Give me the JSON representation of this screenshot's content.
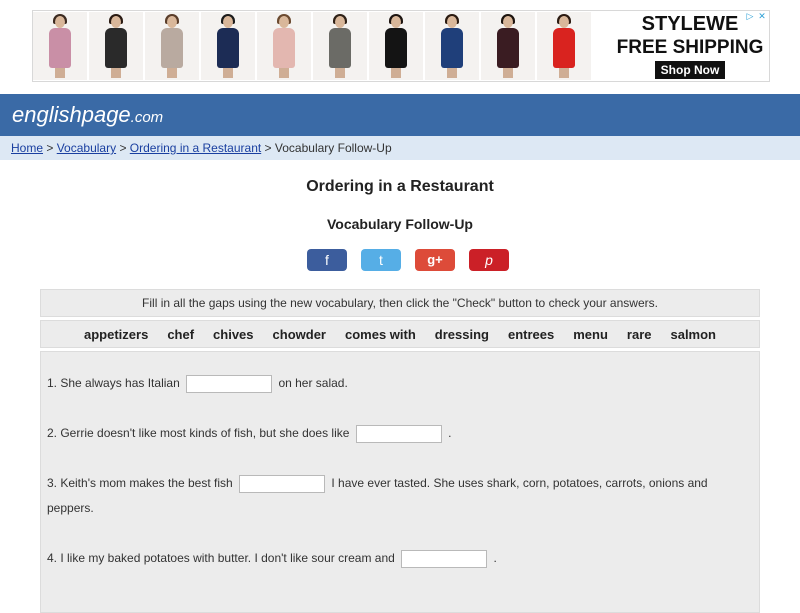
{
  "ad": {
    "brand": "STYLEWE",
    "headline": "FREE SHIPPING",
    "button": "Shop Now",
    "tiles": [
      {
        "dress": "#c98fa6",
        "hair": "#3b2a20"
      },
      {
        "dress": "#2a2a2a",
        "hair": "#2a1a12"
      },
      {
        "dress": "#b9aaa0",
        "hair": "#5a3d2a"
      },
      {
        "dress": "#1c2c55",
        "hair": "#1b1b1b"
      },
      {
        "dress": "#e3b7b0",
        "hair": "#6b4a30"
      },
      {
        "dress": "#6b6b66",
        "hair": "#2e2016"
      },
      {
        "dress": "#141414",
        "hair": "#1d1410"
      },
      {
        "dress": "#1f3f7a",
        "hair": "#2a1a10"
      },
      {
        "dress": "#3a1c22",
        "hair": "#1c130e"
      },
      {
        "dress": "#d9231f",
        "hair": "#2b1b12"
      }
    ]
  },
  "site": {
    "name": "englishpage",
    "tld": ".com"
  },
  "breadcrumb": {
    "links": [
      "Home",
      "Vocabulary",
      "Ordering in a Restaurant"
    ],
    "current": "Vocabulary Follow-Up",
    "separator": ">"
  },
  "page": {
    "title": "Ordering in a Restaurant",
    "subtitle": "Vocabulary Follow-Up"
  },
  "social": {
    "facebook": "f",
    "twitter": "t",
    "google": "g+",
    "pinterest": "p"
  },
  "instructions": "Fill in all the gaps using the new vocabulary, then click the \"Check\" button to check your answers.",
  "word_bank": [
    "appetizers",
    "chef",
    "chives",
    "chowder",
    "comes with",
    "dressing",
    "entrees",
    "menu",
    "rare",
    "salmon"
  ],
  "questions": [
    {
      "before": "1. She always has Italian",
      "after": "on her salad.",
      "value": ""
    },
    {
      "before": "2. Gerrie doesn't like most kinds of fish, but she does like",
      "after": ".",
      "value": ""
    },
    {
      "before": "3. Keith's mom makes the best fish",
      "after": "I have ever tasted. She uses shark, corn, potatoes, carrots, onions and peppers.",
      "value": ""
    },
    {
      "before": "4. I like my baked potatoes with butter. I don't like sour cream and",
      "after": ".",
      "value": ""
    }
  ]
}
